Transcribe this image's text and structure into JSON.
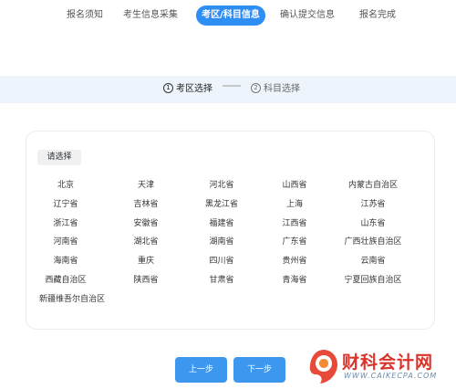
{
  "topnav": {
    "tabs": [
      {
        "label": "报名须知",
        "active": false
      },
      {
        "label": "考生信息采集",
        "active": false
      },
      {
        "label": "考区/科目信息",
        "active": true
      },
      {
        "label": "确认提交信息",
        "active": false
      },
      {
        "label": "报名完成",
        "active": false
      }
    ]
  },
  "steps": [
    {
      "num": "1",
      "label": "考区选择",
      "active": true
    },
    {
      "num": "2",
      "label": "科目选择",
      "active": false
    }
  ],
  "region_panel": {
    "prompt": "请选择",
    "regions": [
      "北京",
      "天津",
      "河北省",
      "山西省",
      "内蒙古自治区",
      "辽宁省",
      "吉林省",
      "黑龙江省",
      "上海",
      "江苏省",
      "浙江省",
      "安徽省",
      "福建省",
      "江西省",
      "山东省",
      "河南省",
      "湖北省",
      "湖南省",
      "广东省",
      "广西壮族自治区",
      "海南省",
      "重庆",
      "四川省",
      "贵州省",
      "云南省",
      "西藏自治区",
      "陕西省",
      "甘肃省",
      "青海省",
      "宁夏回族自治区",
      "新疆维吾尔自治区"
    ]
  },
  "buttons": {
    "prev": "上一步",
    "next": "下一步"
  },
  "watermark": {
    "title": "财科会计网",
    "url": "WWW.CAIKECPA.COM"
  },
  "colors": {
    "accent": "#2f8ef4",
    "button": "#3d97ef",
    "stepbar_bg": "#eef4fb",
    "watermark_red": "#d9342b"
  }
}
